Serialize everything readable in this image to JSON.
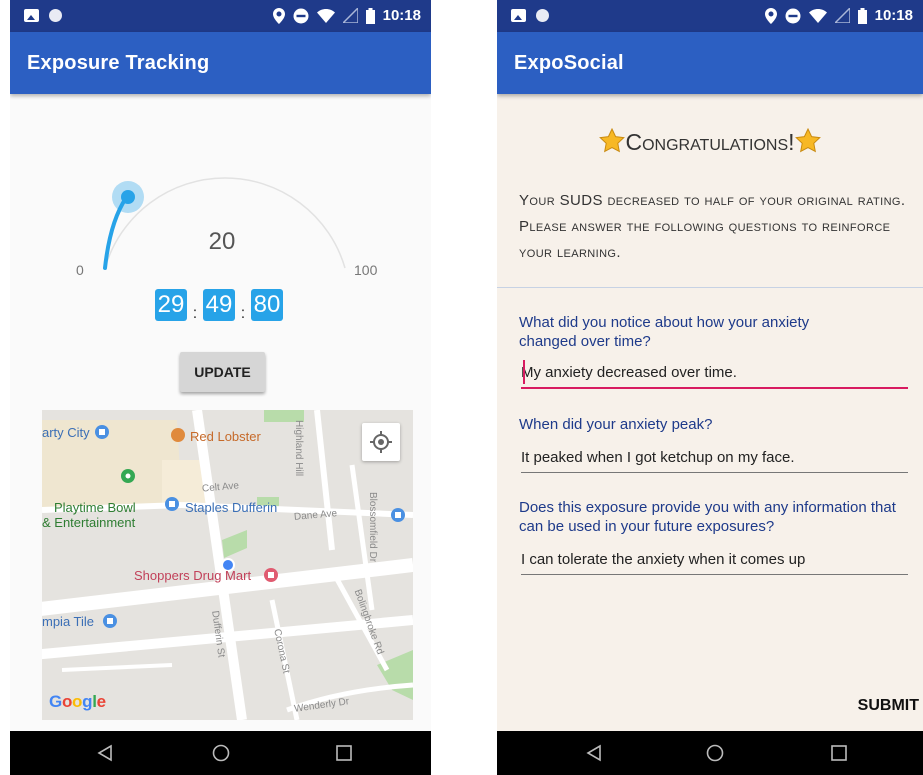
{
  "left_screen": {
    "status": {
      "time": "10:18"
    },
    "appbar_title": "Exposure Tracking",
    "gauge": {
      "min": "0",
      "max": "100",
      "value": "20",
      "level": 20
    },
    "timer": {
      "minutes": "29",
      "seconds": "49",
      "hundredths": "80",
      "sep1": ":",
      "sep2": ":"
    },
    "update_label": "UPDATE",
    "map": {
      "labels": {
        "party_city": "arty City",
        "red_lobster": "Red Lobster",
        "highland_hill": "Highland Hill",
        "celt_ave": "Celt Ave",
        "playtime_1": "Playtime Bowl",
        "playtime_2": "& Entertainment",
        "staples": "Staples Dufferin",
        "dane_ave": "Dane Ave",
        "blossomfield": "Blossomfield Dr",
        "shoppers": "Shoppers Drug Mart",
        "bolingbroke": "Bolingbroke Rd",
        "olympia": "mpia Tile",
        "dufferin": "Dufferin St",
        "corona": "Corona St",
        "wenderly": "Wenderly Dr",
        "google": "Google"
      }
    }
  },
  "right_screen": {
    "status": {
      "time": "10:18"
    },
    "appbar_title": "ExpoSocial",
    "congrats": "Congratulations!",
    "intro": "Your SUDS decreased to half of your original rating. Please answer the following questions to reinforce your learning.",
    "questions": [
      {
        "question": "What did you notice about how your anxiety changed over time?",
        "answer": "My anxiety decreased over time."
      },
      {
        "question": "When did your anxiety peak?",
        "answer": "It peaked when I got ketchup on my face."
      },
      {
        "question": "Does this exposure provide you with any information that can be used in your future exposures?",
        "answer": "I can tolerate the anxiety when it comes up"
      }
    ],
    "submit_label": "SUBMIT"
  },
  "colors": {
    "status_bar": "#1f3a8a",
    "app_bar": "#2c5fc2",
    "gauge_arc": "#27a3e8",
    "accent_pink": "#d81b60"
  },
  "icons": [
    "image-icon",
    "circle-icon",
    "location-icon",
    "dnd-icon",
    "wifi-icon",
    "signal-icon",
    "battery-icon",
    "back-icon",
    "home-icon",
    "recents-icon",
    "star-icon",
    "my-location-icon",
    "map-pin-icon"
  ]
}
